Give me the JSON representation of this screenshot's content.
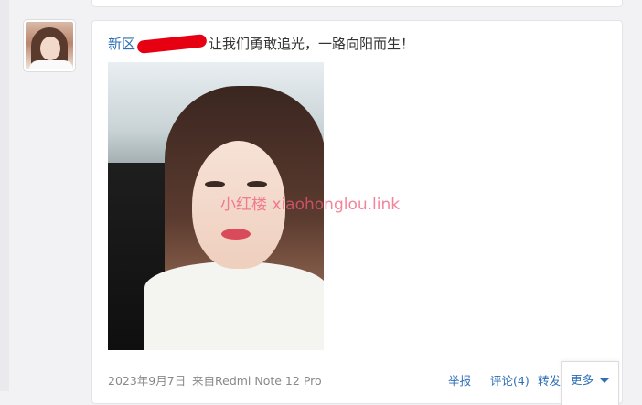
{
  "post": {
    "username": "新区",
    "text": "让我们勇敢追光，一路向阳而生！",
    "watermark": "小红楼  xiaohonglou.link",
    "date": "2023年9月7日",
    "source": "来自Redmi Note 12 Pro"
  },
  "actions": {
    "report": "举报",
    "comment": "评论(4)",
    "repost": "转发",
    "more": "更多"
  },
  "icons": {
    "more_dropdown": "caret-down-icon"
  },
  "colors": {
    "link": "#2d6eb6",
    "redaction": "#e60012",
    "watermark": "#f05a78"
  }
}
